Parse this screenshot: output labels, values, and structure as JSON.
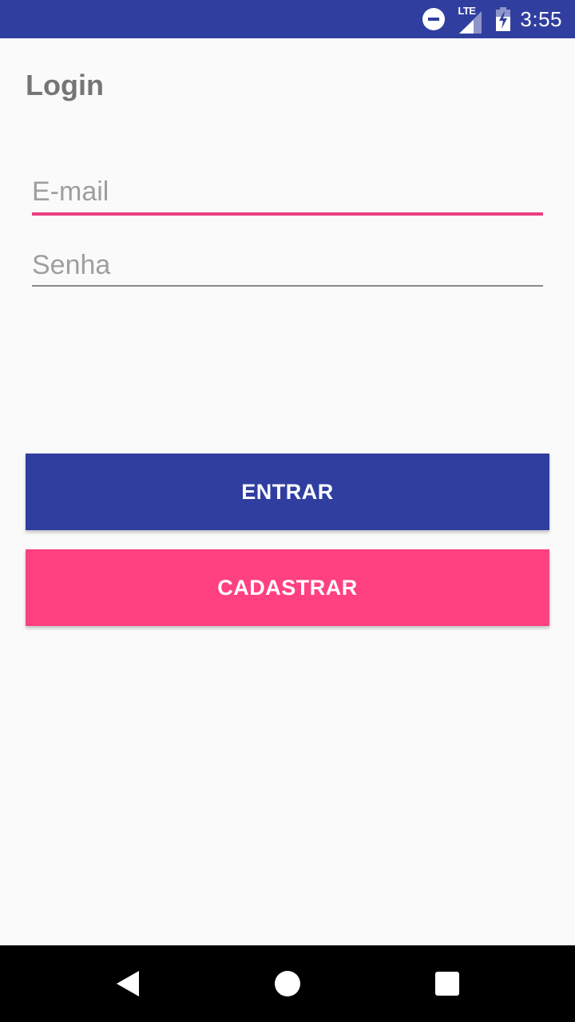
{
  "status_bar": {
    "network_label": "LTE",
    "time": "3:55",
    "icons": [
      "do-not-disturb-icon",
      "lte-signal-icon",
      "battery-charging-icon"
    ],
    "background_color": "#303f9f"
  },
  "login": {
    "title": "Login",
    "email": {
      "placeholder": "E-mail",
      "value": "",
      "focused": true,
      "accent_color": "#e8407f"
    },
    "password": {
      "placeholder": "Senha",
      "value": ""
    },
    "enter_button": {
      "label": "ENTRAR",
      "color": "#303f9f"
    },
    "register_button": {
      "label": "CADASTRAR",
      "color": "#ff4081"
    }
  },
  "nav_bar": {
    "icons": [
      "back-icon",
      "home-icon",
      "recents-icon"
    ]
  }
}
